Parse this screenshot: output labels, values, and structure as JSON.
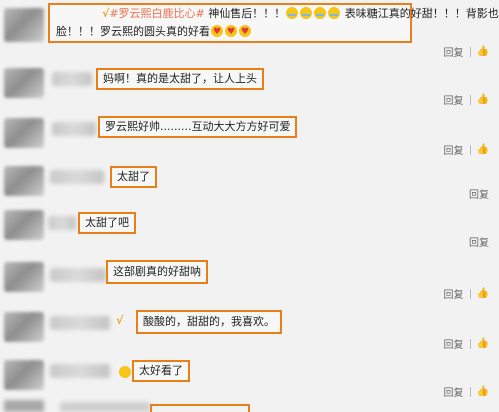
{
  "comments": [
    {
      "verified_mark": "√",
      "topic": "#罗云熙白鹿比心#",
      "line1_text": " 神仙售后！！！",
      "line1_after": " 表味糖江真的好甜！！！背影也配一",
      "line2_before": "脸！！！罗云熙的圆头真的好看",
      "reply": "回复",
      "like": "👍"
    },
    {
      "text": "妈啊！真的是太甜了，让人上头",
      "reply": "回复",
      "like": "👍"
    },
    {
      "text": "罗云熙好帅.........互动大大方方好可爱",
      "reply": "回复",
      "like": "👍"
    },
    {
      "text": "太甜了",
      "reply": "回复"
    },
    {
      "text": "太甜了吧",
      "reply": "回复"
    },
    {
      "text": "这部剧真的好甜呐",
      "reply": "回复",
      "like": "👍"
    },
    {
      "verified_mark": "√",
      "text": "酸酸的，甜甜的，我喜欢。",
      "reply": "回复",
      "like": "👍"
    },
    {
      "text": "太好看了",
      "reply": "回复",
      "like": "👍"
    }
  ],
  "colors": {
    "highlight_border": "#e8801a",
    "topic": "#eb7350",
    "background": "#f2f2f2"
  }
}
